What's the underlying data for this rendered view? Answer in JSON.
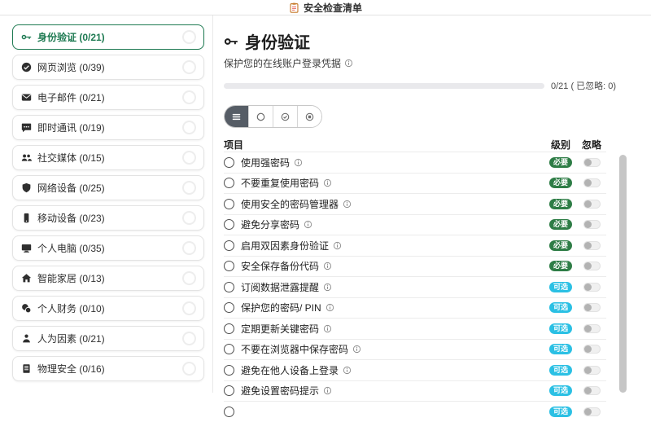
{
  "app": {
    "title": "安全检查清单",
    "title_icon": "clipboard-icon"
  },
  "colors": {
    "accent_green": "#1e7a52",
    "badge_required": "#2e7d46",
    "badge_optional": "#2bc0e4",
    "filter_selected_bg": "#565d66"
  },
  "sidebar": {
    "items": [
      {
        "icon": "key-icon",
        "label": "身份验证 (0/21)",
        "selected": true
      },
      {
        "icon": "browser-icon",
        "label": "网页浏览 (0/39)",
        "selected": false
      },
      {
        "icon": "mail-icon",
        "label": "电子邮件 (0/21)",
        "selected": false
      },
      {
        "icon": "chat-icon",
        "label": "即时通讯 (0/19)",
        "selected": false
      },
      {
        "icon": "users-icon",
        "label": "社交媒体 (0/15)",
        "selected": false
      },
      {
        "icon": "shield-icon",
        "label": "网络设备 (0/25)",
        "selected": false
      },
      {
        "icon": "mobile-icon",
        "label": "移动设备 (0/23)",
        "selected": false
      },
      {
        "icon": "desktop-icon",
        "label": "个人电脑 (0/35)",
        "selected": false
      },
      {
        "icon": "home-icon",
        "label": "智能家居 (0/13)",
        "selected": false
      },
      {
        "icon": "finance-icon",
        "label": "个人财务 (0/10)",
        "selected": false
      },
      {
        "icon": "person-icon",
        "label": "人为因素 (0/21)",
        "selected": false
      },
      {
        "icon": "building-icon",
        "label": "物理安全 (0/16)",
        "selected": false
      }
    ]
  },
  "main": {
    "title": "身份验证",
    "title_icon": "key-icon",
    "subtitle": "保护您的在线账户登录凭据",
    "progress": {
      "completed": 0,
      "total": 21,
      "ignored": 0,
      "label": "0/21 ( 已忽略: 0)"
    },
    "filters": [
      {
        "icon": "list-icon",
        "selected": true
      },
      {
        "icon": "circle-icon",
        "selected": false
      },
      {
        "icon": "check-circle-icon",
        "selected": false
      },
      {
        "icon": "stop-circle-icon",
        "selected": false
      }
    ],
    "table": {
      "headers": {
        "item": "项目",
        "level": "级别",
        "ignore": "忽略"
      },
      "rows": [
        {
          "label": "使用强密码",
          "level": "必要",
          "checked": false,
          "ignored": false
        },
        {
          "label": "不要重复使用密码",
          "level": "必要",
          "checked": false,
          "ignored": false
        },
        {
          "label": "使用安全的密码管理器",
          "level": "必要",
          "checked": false,
          "ignored": false
        },
        {
          "label": "避免分享密码",
          "level": "必要",
          "checked": false,
          "ignored": false
        },
        {
          "label": "启用双因素身份验证",
          "level": "必要",
          "checked": false,
          "ignored": false
        },
        {
          "label": "安全保存备份代码",
          "level": "必要",
          "checked": false,
          "ignored": false
        },
        {
          "label": "订阅数据泄露提醒",
          "level": "可选",
          "checked": false,
          "ignored": false
        },
        {
          "label": "保护您的密码/ PIN",
          "level": "可选",
          "checked": false,
          "ignored": false
        },
        {
          "label": "定期更新关键密码",
          "level": "可选",
          "checked": false,
          "ignored": false
        },
        {
          "label": "不要在浏览器中保存密码",
          "level": "可选",
          "checked": false,
          "ignored": false
        },
        {
          "label": "避免在他人设备上登录",
          "level": "可选",
          "checked": false,
          "ignored": false
        },
        {
          "label": "避免设置密码提示",
          "level": "可选",
          "checked": false,
          "ignored": false
        },
        {
          "label": "",
          "level": "可选",
          "checked": false,
          "ignored": false
        }
      ]
    }
  }
}
